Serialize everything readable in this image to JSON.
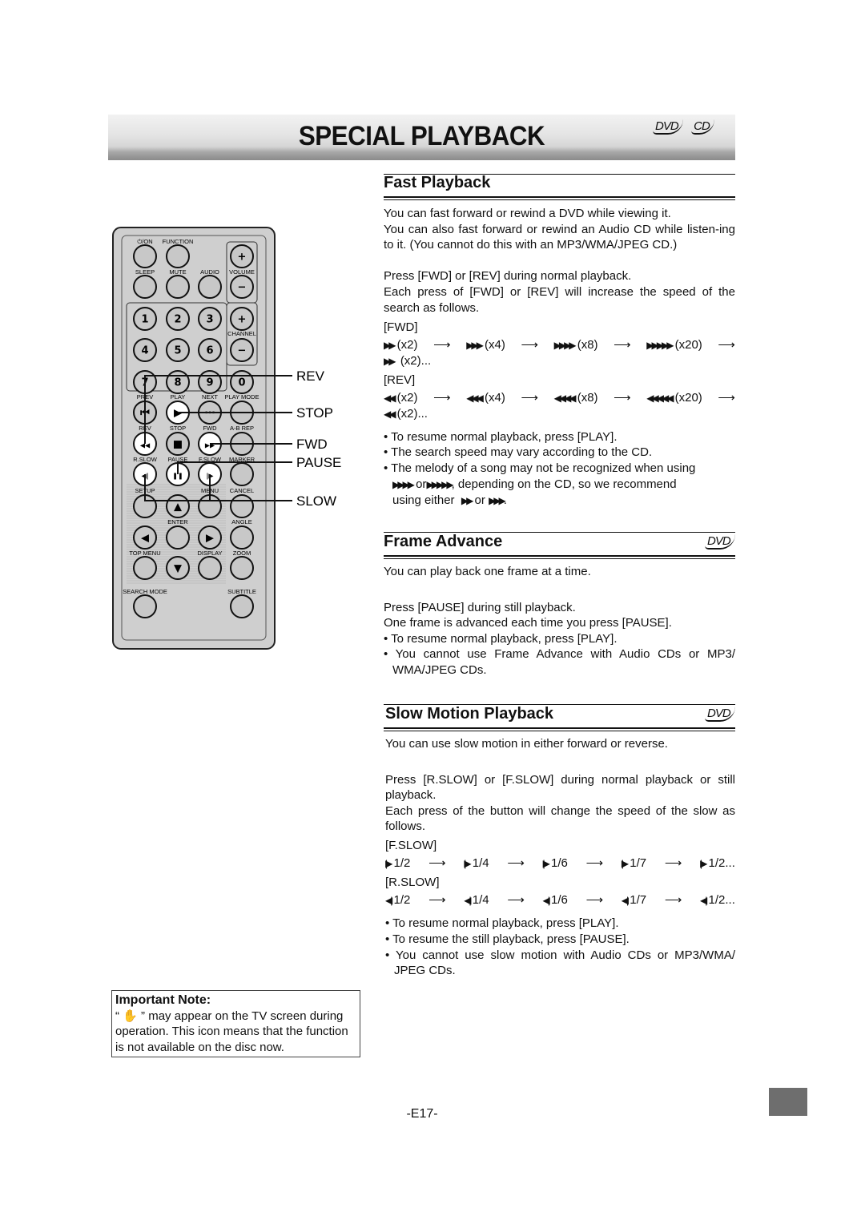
{
  "header": {
    "title": "SPECIAL PLAYBACK",
    "disc_badges": [
      "DVD",
      "CD"
    ]
  },
  "remote": {
    "callouts": [
      "REV",
      "STOP",
      "FWD",
      "PAUSE",
      "SLOW"
    ],
    "labels": [
      "⏻/ON",
      "FUNCTION",
      "SLEEP",
      "MUTE",
      "AUDIO",
      "VOLUME",
      "CHANNEL",
      "PREV",
      "PLAY",
      "NEXT",
      "PLAY MODE",
      "REV",
      "STOP",
      "FWD",
      "A-B REP",
      "R.SLOW",
      "PAUSE",
      "F.SLOW",
      "MARKER",
      "SETUP",
      "MENU",
      "CANCEL",
      "ENTER",
      "ANGLE",
      "TOP MENU",
      "DISPLAY",
      "ZOOM",
      "SEARCH MODE",
      "SUBTITLE"
    ],
    "keys": [
      "+",
      "−",
      "1",
      "2",
      "3",
      "+",
      "4",
      "5",
      "6",
      "−",
      "7",
      "8",
      "9",
      "0"
    ]
  },
  "fast": {
    "heading": "Fast Playback",
    "intro1": "You can fast forward or rewind a DVD while viewing it.",
    "intro2": "You can also fast forward or rewind an Audio CD while listen-ing to it. (You cannot do this with an MP3/WMA/JPEG CD.)",
    "press": "Press [FWD] or [REV] during normal playback.",
    "each": "Each press of [FWD] or [REV] will increase the speed of the search as follows.",
    "fwd_label": "[FWD]",
    "fwd_steps": [
      "(x2)",
      "(x4)",
      "(x8)",
      "(x20)"
    ],
    "fwd_repeat": "(x2)...",
    "rev_label": "[REV]",
    "rev_steps": [
      "(x2)",
      "(x4)",
      "(x8)",
      "(x20)"
    ],
    "rev_repeat": "(x2)...",
    "bullets": [
      "To resume normal playback, press [PLAY].",
      "The search speed may vary according to the CD."
    ],
    "melody_a": "The melody of a song may not be recognized when using",
    "melody_or": "or",
    "melody_b": ", depending on the CD, so we recommend",
    "melody_c": "using either",
    "melody_or2": "or",
    "melody_end": "."
  },
  "frame": {
    "heading": "Frame Advance",
    "badge": "DVD",
    "intro": "You can play back one frame at a time.",
    "press": "Press [PAUSE] during still playback.",
    "each": "One frame is advanced each time you press [PAUSE].",
    "bullets": [
      "To resume normal playback, press [PLAY].",
      "You cannot use Frame Advance with Audio CDs or MP3/ WMA/JPEG CDs."
    ]
  },
  "slow": {
    "heading": "Slow Motion Playback",
    "badge": "DVD",
    "intro": "You can use slow motion in either forward or reverse.",
    "press": "Press [R.SLOW] or [F.SLOW] during normal playback or still playback.",
    "each": "Each press of the button will change the speed of the slow as follows.",
    "f_label": "[F.SLOW]",
    "f_steps": [
      "1/2",
      "1/4",
      "1/6",
      "1/7",
      "1/2..."
    ],
    "r_label": "[R.SLOW]",
    "r_steps": [
      "1/2",
      "1/4",
      "1/6",
      "1/7",
      "1/2..."
    ],
    "bullets": [
      "To resume normal playback, press [PLAY].",
      "To resume the still playback, press [PAUSE].",
      "You cannot use slow motion with Audio CDs or MP3/WMA/ JPEG CDs."
    ]
  },
  "note": {
    "title": "Important Note:",
    "icon": "hand-icon",
    "text_a": "“",
    "text_b": "” may appear on the TV screen during operation. This icon means that the function is not available on the disc now."
  },
  "page_number": "-E17-"
}
